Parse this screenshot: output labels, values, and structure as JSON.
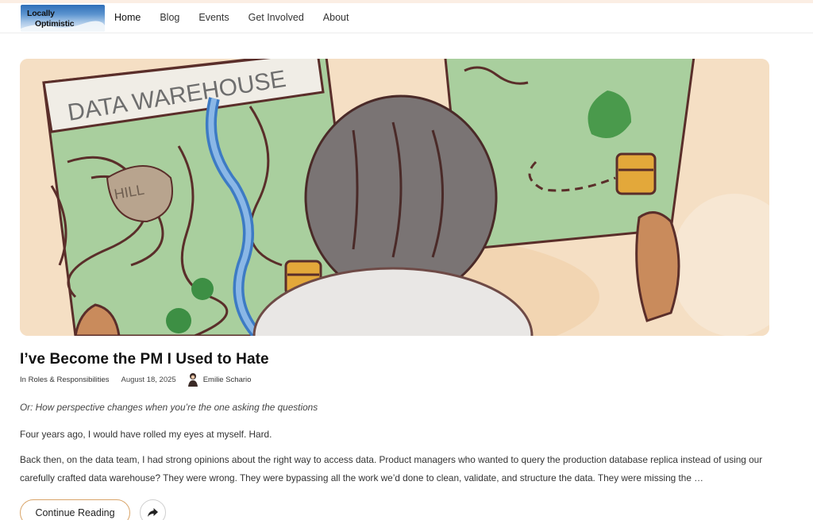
{
  "site": {
    "logo_line1": "Locally",
    "logo_line2": "Optimistic"
  },
  "nav": {
    "items": [
      {
        "label": "Home",
        "active": true
      },
      {
        "label": "Blog"
      },
      {
        "label": "Events"
      },
      {
        "label": "Get Involved"
      },
      {
        "label": "About"
      }
    ]
  },
  "hero": {
    "icon": "illustration-map",
    "map_text": "DATA WAREHOUSE",
    "hill_text": "HILL"
  },
  "post": {
    "title": "I’ve Become the PM I Used to Hate",
    "category_prefix": "In",
    "category": "Roles & Responsibilities",
    "date": "August 18, 2025",
    "author": "Emilie Schario",
    "subtitle": "Or: How perspective changes when you’re the one asking the questions",
    "paragraph1": "Four years ago, I would have rolled my eyes at myself. Hard.",
    "paragraph2": "Back then, on the data team, I had strong opinions about the right way to access data. Product managers who wanted to query the production database replica instead of using our carefully crafted data warehouse? They were wrong. They were bypassing all the work we’d done to clean, validate, and structure the data. They were missing the …",
    "continue_label": "Continue Reading",
    "share_icon": "share-arrow-icon"
  },
  "colors": {
    "accent_border": "#d9a56a",
    "logo_blue": "#2f6fb8"
  }
}
